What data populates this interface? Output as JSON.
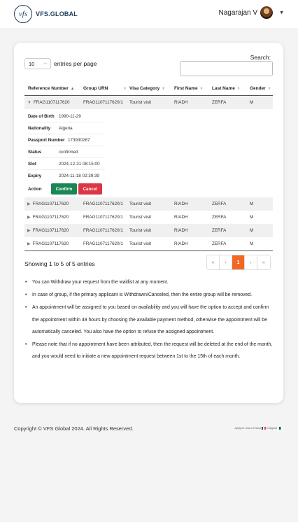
{
  "header": {
    "logo_mark": "vfs",
    "brand": "VFS.GLOBAL",
    "user_name": "Nagarajan V",
    "caret": "▼"
  },
  "table_controls": {
    "page_length": "10",
    "entries_label": "entries per page",
    "search_label": "Search:",
    "search_value": ""
  },
  "columns": [
    "Reference Number",
    "Group URN",
    "Visa Category",
    "First Name",
    "Last Name",
    "Gender"
  ],
  "rows": [
    {
      "ref": "FRAG1107117620",
      "urn": "FRAG1107117620/1",
      "visa": "Tourist visit",
      "first": "RIADH",
      "last": "ZERFA",
      "gender": "M"
    },
    {
      "ref": "FRAG1107117620",
      "urn": "FRAG1107117620/1",
      "visa": "Tourist visit",
      "first": "RIADH",
      "last": "ZERFA",
      "gender": "M"
    },
    {
      "ref": "FRAG1107117620",
      "urn": "FRAG1107117620/1",
      "visa": "Tourist visit",
      "first": "RIADH",
      "last": "ZERFA",
      "gender": "M"
    },
    {
      "ref": "FRAG1107117620",
      "urn": "FRAG1107117620/1",
      "visa": "Tourist visit",
      "first": "RIADH",
      "last": "ZERFA",
      "gender": "M"
    },
    {
      "ref": "FRAG1107117620",
      "urn": "FRAG1107117620/1",
      "visa": "Tourist visit",
      "first": "RIADH",
      "last": "ZERFA",
      "gender": "M"
    }
  ],
  "details": {
    "labels": [
      "Date of Birth",
      "Nationality",
      "Passport Number",
      "Status",
      "Slot",
      "Expiry"
    ],
    "values": [
      "1990-11-29",
      "Algeria",
      "173930287",
      "confirmed",
      "2024-12-31 08:15:00",
      "2024-11-18 02:39:39"
    ],
    "action_label": "Action",
    "confirm_label": "Confirm",
    "cancel_label": "Cancel"
  },
  "pagination": {
    "info": "Showing 1 to 5 of 5 entries",
    "first": "«",
    "prev": "‹",
    "current": "1",
    "next": "›",
    "last": "»"
  },
  "notes": [
    "You can Withdraw your request from the waitlist at any moment.",
    "In case of group, if the primary applicant is Withdrawn/Canceled, then the entire group will be removed.",
    "An appointment will be assigned to you based on availability and you will have the option to accept and confirm the appointment within 48 hours by choosing the available payment method, otherwise the appointment will be automatically canceled. You also have the option to refuse the assigned appointment.",
    "Please note that if no appointment have been attributed, then the request will be deleted at the end of the month, and you would need to initiate a new appointment request between 1st to the 15th of each month."
  ],
  "footer": {
    "copyright": "Copyright © VFS Global 2024. All Rights Reserved.",
    "apply_text": "Apply for visa to France",
    "apply_suffix": "in Algeria"
  },
  "colors": {
    "accent": "#f26722",
    "confirm": "#198754",
    "cancel": "#dc3545",
    "brand": "#1f3d5c"
  }
}
